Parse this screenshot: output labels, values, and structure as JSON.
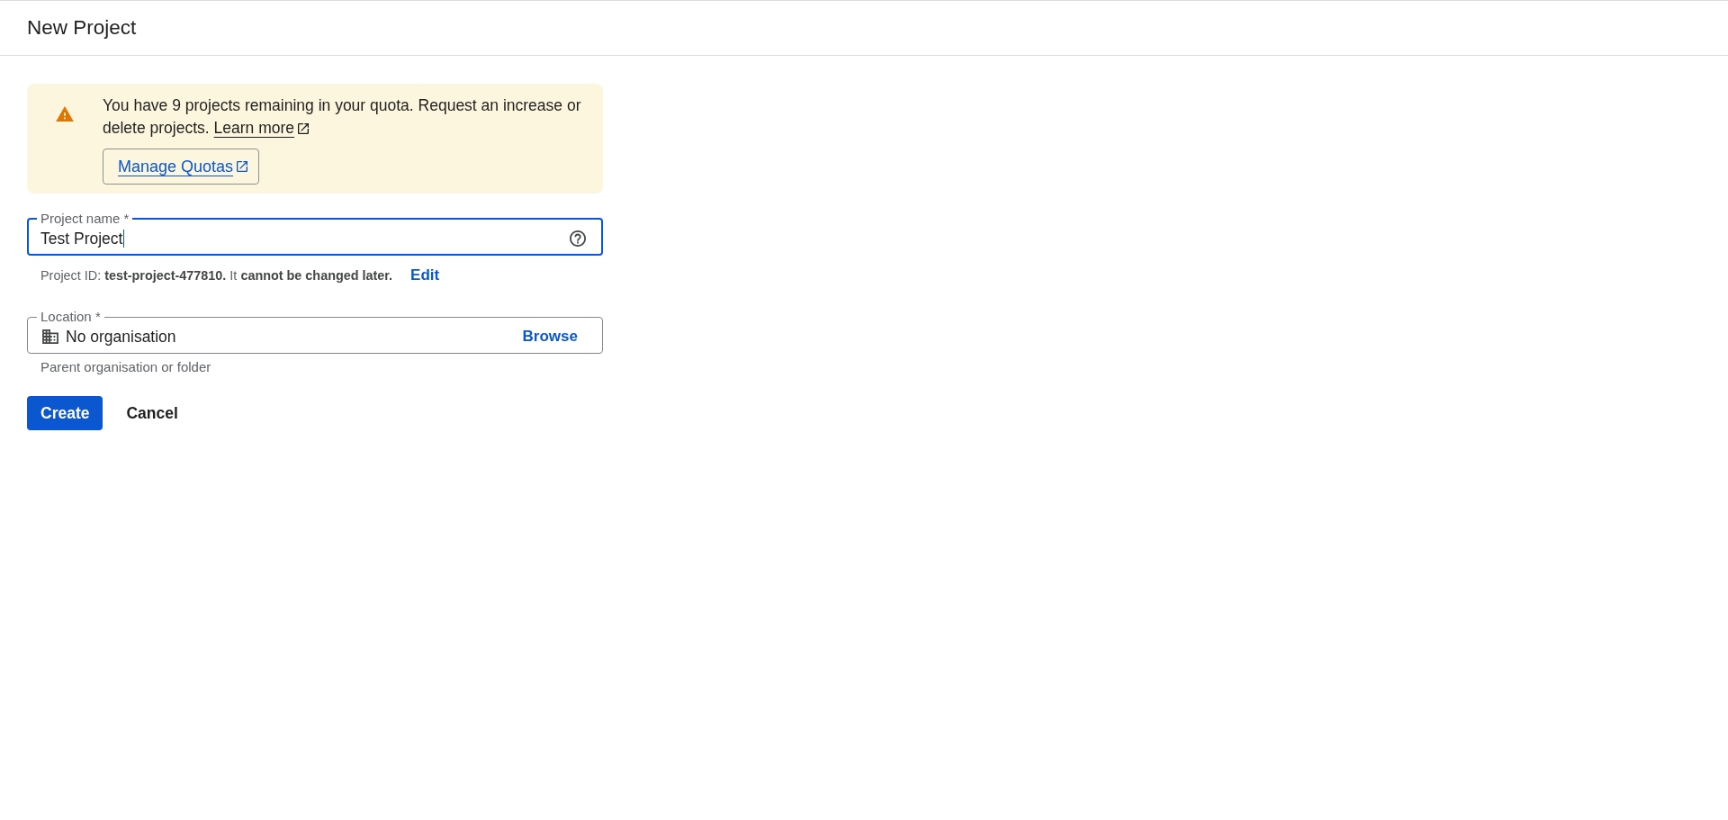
{
  "header": {
    "title": "New Project"
  },
  "quota_notice": {
    "message": "You have 9 projects remaining in your quota. Request an increase or delete projects.",
    "link": "Learn more",
    "button": "Manage Quotas"
  },
  "project_name": {
    "label": "Project name *",
    "value": "Test Project",
    "focused": true,
    "hint": "Project ID: **test-project-477810.** It **cannot be changed later.**",
    "action": "Edit"
  },
  "location": {
    "label": "Location *",
    "value": "No organisation",
    "focused": false,
    "action": "Browse",
    "helper": "Parent organisation or folder"
  },
  "buttons": [
    {
      "label": "Create",
      "kind": "primary"
    },
    {
      "label": "Cancel",
      "kind": "text"
    }
  ]
}
